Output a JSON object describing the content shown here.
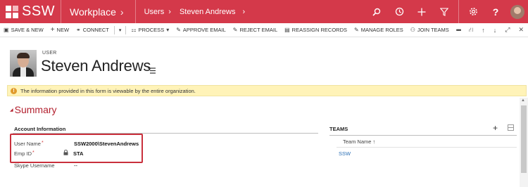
{
  "topbar": {
    "brand": "SSW",
    "app": "Workplace",
    "breadcrumb": [
      "Users",
      "Steven Andrews"
    ],
    "icons": [
      "search-icon",
      "history-icon",
      "add-icon",
      "filter-icon",
      "settings-icon",
      "help-icon",
      "user-avatar"
    ]
  },
  "commands": [
    {
      "label": "SAVE & NEW",
      "icon": "save-new-icon"
    },
    {
      "label": "NEW",
      "icon": "plus-icon"
    },
    {
      "label": "CONNECT",
      "icon": "connect-icon"
    },
    {
      "label": "PROCESS",
      "icon": "process-icon"
    },
    {
      "label": "APPROVE EMAIL",
      "icon": "approve-email-icon"
    },
    {
      "label": "REJECT EMAIL",
      "icon": "reject-email-icon"
    },
    {
      "label": "REASSIGN RECORDS",
      "icon": "reassign-icon"
    },
    {
      "label": "MANAGE ROLES",
      "icon": "manage-roles-icon"
    },
    {
      "label": "JOIN TEAMS",
      "icon": "join-teams-icon"
    },
    {
      "label": "•••",
      "icon": "more-icon"
    }
  ],
  "header": {
    "entity": "USER",
    "name": "Steven Andrews"
  },
  "notice": "The information provided in this form is viewable by the entire organization.",
  "summary": {
    "title": "Summary",
    "section": "Account Information",
    "fields": [
      {
        "label": "User Name",
        "required": "*",
        "value": "SSW2000\\StevenAndrews"
      },
      {
        "label": "Emp ID",
        "required": "*",
        "value": "STA"
      },
      {
        "label": "Skype Username",
        "value": "--"
      }
    ]
  },
  "teams": {
    "title": "TEAMS",
    "column": "Team Name ↑",
    "items": [
      "SSW"
    ]
  },
  "colors": {
    "brand": "#d4394a",
    "accent_text": "#b3212f",
    "link": "#2a6fb5",
    "notice_bg": "#fff3b8"
  }
}
